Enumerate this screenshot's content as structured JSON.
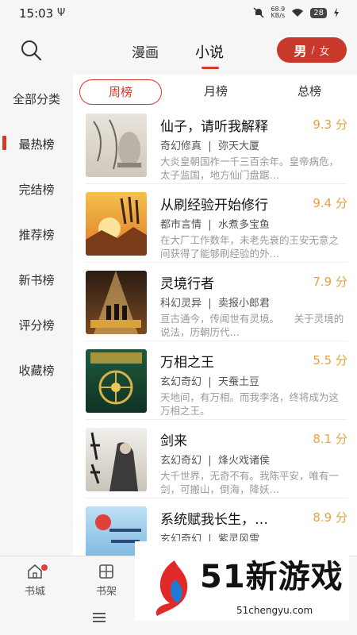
{
  "status_bar": {
    "time": "15:03",
    "usb_glyph": "Ψ",
    "net_speed": "68.9",
    "net_unit": "KB/s",
    "battery": "28",
    "icons": [
      "mute-icon",
      "wifi-icon",
      "battery-icon",
      "charging-icon"
    ]
  },
  "header": {
    "tab_comic": "漫画",
    "tab_novel": "小说",
    "gender_male": "男",
    "gender_sep": "/",
    "gender_female": "女"
  },
  "sidebar": {
    "items": [
      "全部分类",
      "最热榜",
      "完结榜",
      "推荐榜",
      "新书榜",
      "评分榜",
      "收藏榜"
    ],
    "active_index": 1
  },
  "rank_tabs": [
    "周榜",
    "月榜",
    "总榜"
  ],
  "books": [
    {
      "title": "仙子，请听我解释",
      "score": "9.3 分",
      "genre": "奇幻修真",
      "author": "弥天大厦",
      "desc": "大炎皇朝国祚一千三百余年。皇帝病危，太子监国，地方仙门盘踞…"
    },
    {
      "title": "从刷经验开始修行",
      "score": "9.4 分",
      "genre": "都市言情",
      "author": "水煮多宝鱼",
      "desc": "在大厂工作数年，未老先衰的王安无意之间获得了能够刷经验的外…"
    },
    {
      "title": "灵境行者",
      "score": "7.9 分",
      "genre": "科幻灵异",
      "author": "卖报小郎君",
      "desc": "亘古通今，传闻世有灵境。　　关于灵境的说法，历朝历代…"
    },
    {
      "title": "万相之王",
      "score": "5.5 分",
      "genre": "玄幻奇幻",
      "author": "天蚕土豆",
      "desc": "天地间，有万相。而我李洛，终将成为这万相之王。"
    },
    {
      "title": "剑来",
      "score": "8.1 分",
      "genre": "玄幻奇幻",
      "author": "烽火戏诸侯",
      "desc": "大千世界，无奇不有。我陈平安，唯有一剑，可搬山，倒海，降妖…"
    },
    {
      "title": "系统赋我长生，…",
      "score": "8.9 分",
      "genre": "玄幻奇幻",
      "author": "紫灵风雪",
      "desc": ""
    }
  ],
  "bottom_nav": {
    "bookstore": "书城",
    "bookshelf": "书架"
  },
  "watermark": {
    "brand": "51新游戏",
    "url": "51chengyu.com"
  },
  "colors": {
    "accent": "#d23b2a",
    "score": "#e6a23c",
    "background": "#f6f6f6"
  }
}
